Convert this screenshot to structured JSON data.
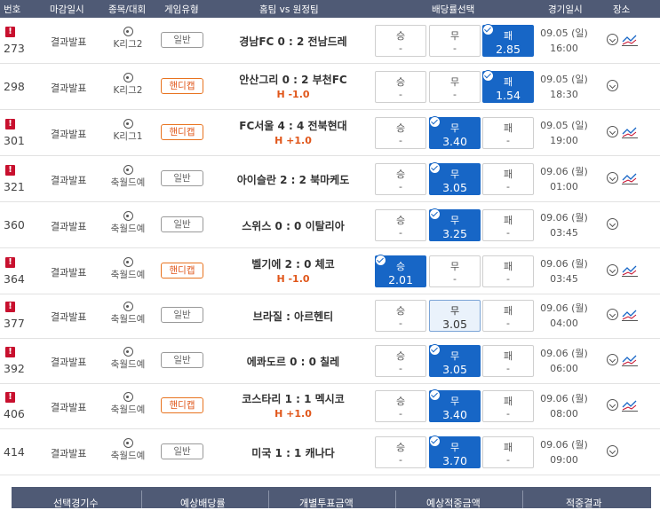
{
  "header": {
    "number": "번호",
    "deadline": "마감일시",
    "sport": "종목/대회",
    "game_type": "게임유형",
    "teams": "홈팀 vs 원정팀",
    "odds_select": "배당률선택",
    "match_time": "경기일시",
    "venue": "장소"
  },
  "rows": [
    {
      "alert": "!",
      "num": "273",
      "deadline": "결과발표",
      "league": "K리그2",
      "type": "일반",
      "handicap": false,
      "match": "경남FC 0 : 2 전남드레",
      "hval": "",
      "win_l": "승",
      "win_v": "-",
      "draw_l": "무",
      "draw_v": "-",
      "lose_l": "패",
      "lose_v": "2.85",
      "selected": "lose",
      "date": "09.05 (일)",
      "time": "16:00",
      "trend": true
    },
    {
      "alert": "",
      "num": "298",
      "deadline": "결과발표",
      "league": "K리그2",
      "type": "핸디캡",
      "handicap": true,
      "match": "안산그리 0 : 2 부천FC",
      "hval": "H -1.0",
      "win_l": "승",
      "win_v": "-",
      "draw_l": "무",
      "draw_v": "-",
      "lose_l": "패",
      "lose_v": "1.54",
      "selected": "lose",
      "date": "09.05 (일)",
      "time": "18:30",
      "trend": false
    },
    {
      "alert": "!",
      "num": "301",
      "deadline": "결과발표",
      "league": "K리그1",
      "type": "핸디캡",
      "handicap": true,
      "match": "FC서울 4 : 4 전북현대",
      "hval": "H +1.0",
      "win_l": "승",
      "win_v": "-",
      "draw_l": "무",
      "draw_v": "3.40",
      "lose_l": "패",
      "lose_v": "-",
      "selected": "draw",
      "date": "09.05 (일)",
      "time": "19:00",
      "trend": true
    },
    {
      "alert": "!",
      "num": "321",
      "deadline": "결과발표",
      "league": "축월드예",
      "type": "일반",
      "handicap": false,
      "match": "아이슬란 2 : 2 북마케도",
      "hval": "",
      "win_l": "승",
      "win_v": "-",
      "draw_l": "무",
      "draw_v": "3.05",
      "lose_l": "패",
      "lose_v": "-",
      "selected": "draw",
      "date": "09.06 (월)",
      "time": "01:00",
      "trend": true
    },
    {
      "alert": "",
      "num": "360",
      "deadline": "결과발표",
      "league": "축월드예",
      "type": "일반",
      "handicap": false,
      "match": "스위스 0 : 0 이탈리아",
      "hval": "",
      "win_l": "승",
      "win_v": "-",
      "draw_l": "무",
      "draw_v": "3.25",
      "lose_l": "패",
      "lose_v": "-",
      "selected": "draw",
      "date": "09.06 (월)",
      "time": "03:45",
      "trend": false
    },
    {
      "alert": "!",
      "num": "364",
      "deadline": "결과발표",
      "league": "축월드예",
      "type": "핸디캡",
      "handicap": true,
      "match": "벨기에 2 : 0 체코",
      "hval": "H -1.0",
      "win_l": "승",
      "win_v": "2.01",
      "draw_l": "무",
      "draw_v": "-",
      "lose_l": "패",
      "lose_v": "-",
      "selected": "win",
      "date": "09.06 (월)",
      "time": "03:45",
      "trend": true
    },
    {
      "alert": "!",
      "num": "377",
      "deadline": "결과발표",
      "league": "축월드예",
      "type": "일반",
      "handicap": false,
      "match": "브라질 : 아르헨티",
      "hval": "",
      "win_l": "승",
      "win_v": "-",
      "draw_l": "무",
      "draw_v": "3.05",
      "lose_l": "패",
      "lose_v": "-",
      "selected": "draw-soft",
      "date": "09.06 (월)",
      "time": "04:00",
      "trend": true
    },
    {
      "alert": "!",
      "num": "392",
      "deadline": "결과발표",
      "league": "축월드예",
      "type": "일반",
      "handicap": false,
      "match": "에콰도르 0 : 0 칠레",
      "hval": "",
      "win_l": "승",
      "win_v": "-",
      "draw_l": "무",
      "draw_v": "3.05",
      "lose_l": "패",
      "lose_v": "-",
      "selected": "draw",
      "date": "09.06 (월)",
      "time": "06:00",
      "trend": true
    },
    {
      "alert": "!",
      "num": "406",
      "deadline": "결과발표",
      "league": "축월드예",
      "type": "핸디캡",
      "handicap": true,
      "match": "코스타리 1 : 1 멕시코",
      "hval": "H +1.0",
      "win_l": "승",
      "win_v": "-",
      "draw_l": "무",
      "draw_v": "3.40",
      "lose_l": "패",
      "lose_v": "-",
      "selected": "draw",
      "date": "09.06 (월)",
      "time": "08:00",
      "trend": true
    },
    {
      "alert": "",
      "num": "414",
      "deadline": "결과발표",
      "league": "축월드예",
      "type": "일반",
      "handicap": false,
      "match": "미국 1 : 1 캐나다",
      "hval": "",
      "win_l": "승",
      "win_v": "-",
      "draw_l": "무",
      "draw_v": "3.70",
      "lose_l": "패",
      "lose_v": "-",
      "selected": "draw",
      "date": "09.06 (월)",
      "time": "09:00",
      "trend": false
    }
  ],
  "footer": {
    "selected_count": "선택경기수",
    "expected_odds": "예상배당률",
    "stake": "개별투표금액",
    "expected_payout": "예상적중금액",
    "result": "적중결과"
  },
  "colors": {
    "header_bg": "#4f5a75",
    "selected_bg": "#1766c6",
    "alert": "#c8102e",
    "handicap": "#e0561a"
  }
}
